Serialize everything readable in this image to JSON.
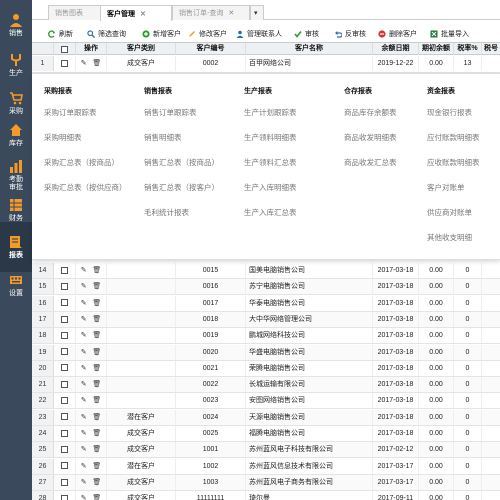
{
  "sidebar": {
    "items": [
      {
        "label": "销售",
        "icon": "user-icon"
      },
      {
        "label": "生产",
        "icon": "fork-icon"
      },
      {
        "label": "采购",
        "icon": "cart-icon"
      },
      {
        "label": "库存",
        "icon": "home-icon"
      },
      {
        "label": "考勤\n审批",
        "icon": "chart-icon"
      },
      {
        "label": "财务",
        "icon": "ledger-icon"
      },
      {
        "label": "报表",
        "icon": "report-icon"
      },
      {
        "label": "设置",
        "icon": "keyboard-icon"
      }
    ],
    "active_label": "报表"
  },
  "tabs": [
    {
      "label": "销售图表",
      "closable": false
    },
    {
      "label": "客户管理",
      "closable": true
    },
    {
      "label": "销售订单-查询",
      "closable": true
    }
  ],
  "tab_dropdown": "▾",
  "toolbar": {
    "refresh": "刷新",
    "filter": "筛选查询",
    "add": "新增客户",
    "edit": "修改客户",
    "contact": "管理联系人",
    "audit": "审核",
    "unaudit": "反审核",
    "delete": "删除客户",
    "import": "批量导入"
  },
  "table": {
    "headers": [
      "操作",
      "客户类别",
      "客户编号",
      "客户名称",
      "余额日期",
      "期初余额",
      "税率%",
      "税号"
    ],
    "top_row": {
      "num": "1",
      "category": "成交客户",
      "code": "0002",
      "name": "百甲网络公司",
      "date": "2019-12-22",
      "balance": "0.00",
      "tax": "13",
      "taxno": ""
    },
    "rows": [
      {
        "num": "14",
        "category": "",
        "code": "0015",
        "name": "国美电脑销售公司",
        "date": "2017-03-18",
        "balance": "0.00",
        "tax": "0"
      },
      {
        "num": "15",
        "category": "",
        "code": "0016",
        "name": "苏宁电脑销售公司",
        "date": "2017-03-18",
        "balance": "0.00",
        "tax": "0"
      },
      {
        "num": "16",
        "category": "",
        "code": "0017",
        "name": "华泰电脑销售公司",
        "date": "2017-03-18",
        "balance": "0.00",
        "tax": "0"
      },
      {
        "num": "17",
        "category": "",
        "code": "0018",
        "name": "大中华网络管理公司",
        "date": "2017-03-18",
        "balance": "0.00",
        "tax": "0"
      },
      {
        "num": "18",
        "category": "",
        "code": "0019",
        "name": "鹏城网络科技公司",
        "date": "2017-03-18",
        "balance": "0.00",
        "tax": "0"
      },
      {
        "num": "19",
        "category": "",
        "code": "0020",
        "name": "华盛电脑销售公司",
        "date": "2017-03-18",
        "balance": "0.00",
        "tax": "0"
      },
      {
        "num": "20",
        "category": "",
        "code": "0021",
        "name": "荣腾电脑销售公司",
        "date": "2017-03-18",
        "balance": "0.00",
        "tax": "0"
      },
      {
        "num": "21",
        "category": "",
        "code": "0022",
        "name": "长城运输有限公司",
        "date": "2017-03-18",
        "balance": "0.00",
        "tax": "0"
      },
      {
        "num": "22",
        "category": "",
        "code": "0023",
        "name": "安图网络销售公司",
        "date": "2017-03-18",
        "balance": "0.00",
        "tax": "0"
      },
      {
        "num": "23",
        "category": "潜在客户",
        "code": "0024",
        "name": "天源电脑销售公司",
        "date": "2017-03-18",
        "balance": "0.00",
        "tax": "0"
      },
      {
        "num": "24",
        "category": "成交客户",
        "code": "0025",
        "name": "福腾电脑销售公司",
        "date": "2017-03-18",
        "balance": "0.00",
        "tax": "0"
      },
      {
        "num": "25",
        "category": "成交客户",
        "code": "1001",
        "name": "苏州蓝风电子科技有限公司",
        "date": "2017-02-12",
        "balance": "0.00",
        "tax": "0"
      },
      {
        "num": "26",
        "category": "潜在客户",
        "code": "1002",
        "name": "苏州蓝风信息技术有限公司",
        "date": "2017-03-17",
        "balance": "0.00",
        "tax": "0"
      },
      {
        "num": "27",
        "category": "成交客户",
        "code": "1003",
        "name": "苏州蓝风电子商务有限公司",
        "date": "2017-03-17",
        "balance": "0.00",
        "tax": "0"
      },
      {
        "num": "28",
        "category": "成交客户",
        "code": "11111111",
        "name": "琦尔曼",
        "date": "2017-09-11",
        "balance": "0.00",
        "tax": "0"
      }
    ]
  },
  "menu": {
    "columns": [
      {
        "title": "采购报表",
        "items": [
          "采购订单跟踪表",
          "采购明细表",
          "采购汇总表（按商品）",
          "采购汇总表（按供应商）"
        ]
      },
      {
        "title": "销售报表",
        "items": [
          "销售订单跟踪表",
          "销售明细表",
          "销售汇总表（按商品）",
          "销售汇总表（按客户）",
          "毛利统计报表"
        ]
      },
      {
        "title": "生产报表",
        "items": [
          "生产计划跟踪表",
          "生产领料明细表",
          "生产领料汇总表",
          "生产入库明细表",
          "生产入库汇总表"
        ]
      },
      {
        "title": "仓存报表",
        "items": [
          "商品库存余额表",
          "商品收发明细表",
          "商品收发汇总表"
        ]
      },
      {
        "title": "资金报表",
        "items": [
          "现金银行报表",
          "应付账款明细表",
          "应收账款明细表",
          "客户对账单",
          "供应商对账单",
          "其他收支明细"
        ]
      }
    ]
  }
}
